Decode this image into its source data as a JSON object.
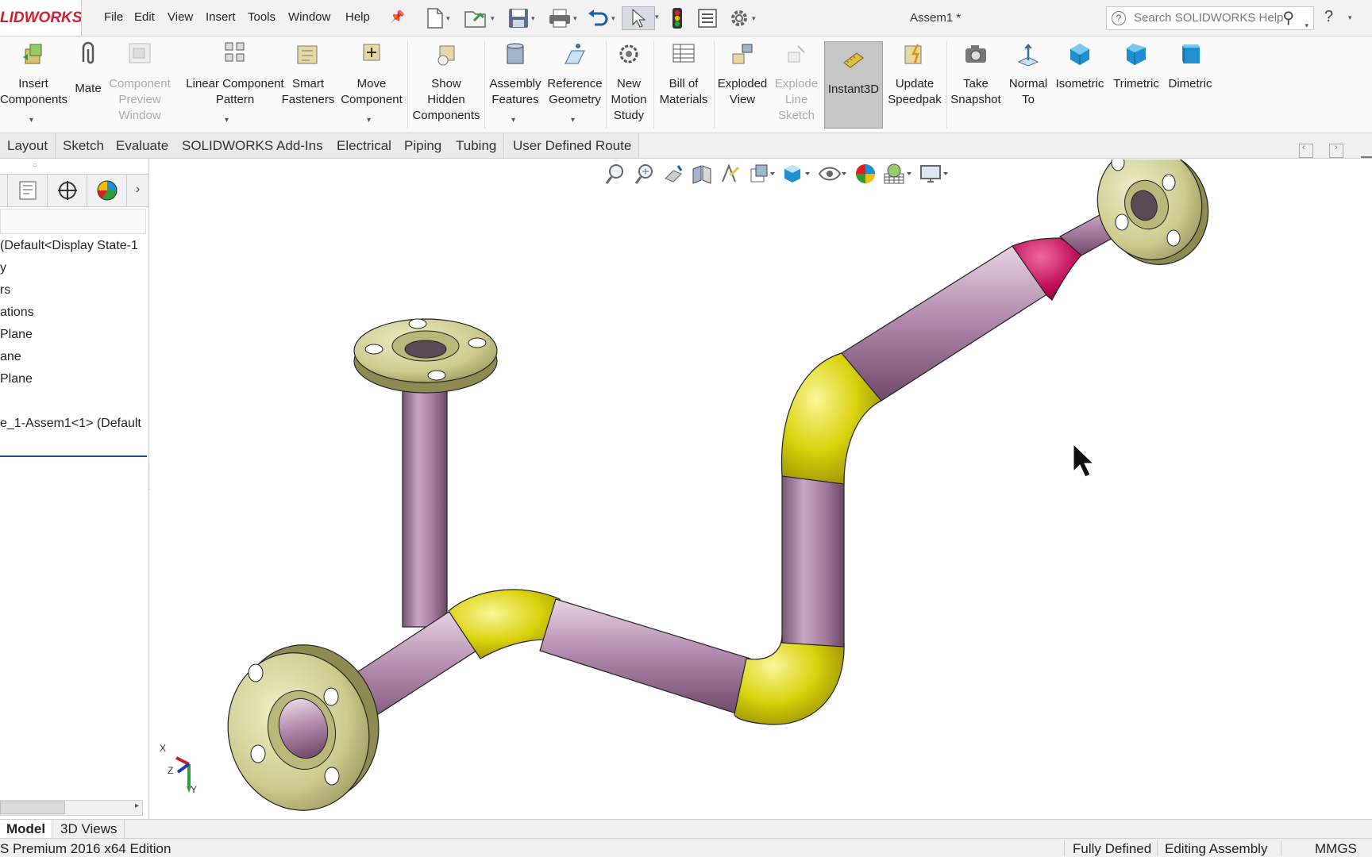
{
  "app": {
    "logo": "LIDWORKS",
    "doc_title": "Assem1 *"
  },
  "menu": [
    "File",
    "Edit",
    "View",
    "Insert",
    "Tools",
    "Window",
    "Help"
  ],
  "search": {
    "placeholder": "Search SOLIDWORKS Help"
  },
  "ribbon": {
    "insert_components": [
      "Insert",
      "Components"
    ],
    "mate": [
      "Mate"
    ],
    "component_preview": [
      "Component",
      "Preview",
      "Window"
    ],
    "linear_pattern": [
      "Linear Component",
      "Pattern"
    ],
    "smart_fasteners": [
      "Smart",
      "Fasteners"
    ],
    "move_component": [
      "Move",
      "Component"
    ],
    "show_hidden": [
      "Show",
      "Hidden",
      "Components"
    ],
    "assembly_features": [
      "Assembly",
      "Features"
    ],
    "reference_geometry": [
      "Reference",
      "Geometry"
    ],
    "motion_study": [
      "New",
      "Motion",
      "Study"
    ],
    "bom": [
      "Bill of",
      "Materials"
    ],
    "exploded_view": [
      "Exploded",
      "View"
    ],
    "explode_line": [
      "Explode",
      "Line",
      "Sketch"
    ],
    "instant3d": [
      "Instant3D"
    ],
    "speedpak": [
      "Update",
      "Speedpak"
    ],
    "snapshot": [
      "Take",
      "Snapshot"
    ],
    "normal_to": [
      "Normal",
      "To"
    ],
    "isometric": [
      "Isometric"
    ],
    "trimetric": [
      "Trimetric"
    ],
    "dimetric": [
      "Dimetric"
    ]
  },
  "tabs": [
    "Layout",
    "Sketch",
    "Evaluate",
    "SOLIDWORKS Add-Ins",
    "Electrical",
    "Piping",
    "Tubing",
    "User Defined Route"
  ],
  "tree": [
    "(Default<Display State-1",
    "y",
    "rs",
    "ations",
    "Plane",
    "ane",
    "Plane",
    "e_1-Assem1<1> (Default"
  ],
  "bottom_tabs": [
    "Model",
    "3D Views"
  ],
  "status": {
    "edition": "S Premium 2016 x64 Edition",
    "defined": "Fully Defined",
    "mode": "Editing Assembly",
    "units": "MMGS"
  },
  "triad": {
    "x": "X",
    "y": "Y",
    "z": "Z"
  },
  "colors": {
    "pipe": "#b58bb0",
    "elbow": "#d9d20c",
    "flange": "#cdcb8e",
    "reducer": "#c2105a",
    "brand": "#d21f2f"
  }
}
